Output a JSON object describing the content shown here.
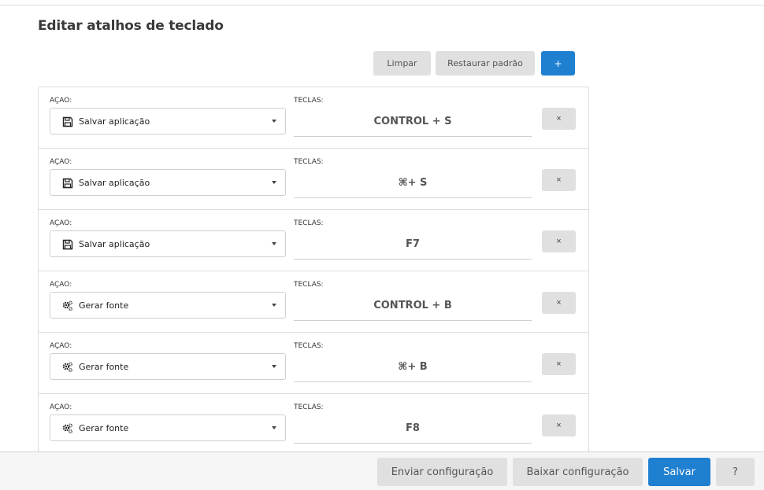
{
  "page": {
    "title": "Editar atalhos de teclado"
  },
  "toolbar": {
    "clear_label": "Limpar",
    "restore_label": "Restaurar padrão",
    "add_label": "+"
  },
  "labels": {
    "action": "AÇAO:",
    "keys": "TECLAS:",
    "remove": "×"
  },
  "shortcuts": [
    {
      "icon": "floppy-disk-icon",
      "action": "Salvar aplicação",
      "keys": "CONTROL + S"
    },
    {
      "icon": "floppy-disk-icon",
      "action": "Salvar aplicação",
      "keys": "⌘+ S"
    },
    {
      "icon": "floppy-disk-icon",
      "action": "Salvar aplicação",
      "keys": "F7"
    },
    {
      "icon": "cogs-icon",
      "action": "Gerar fonte",
      "keys": "CONTROL + B"
    },
    {
      "icon": "cogs-icon",
      "action": "Gerar fonte",
      "keys": "⌘+ B"
    },
    {
      "icon": "cogs-icon",
      "action": "Gerar fonte",
      "keys": "F8"
    }
  ],
  "footer": {
    "send_label": "Enviar configuração",
    "download_label": "Baixar configuração",
    "save_label": "Salvar",
    "help_label": "?"
  },
  "colors": {
    "primary": "#1f7fd1",
    "button_gray": "#e0e0e0",
    "footer_bg": "#f5f5f5"
  }
}
